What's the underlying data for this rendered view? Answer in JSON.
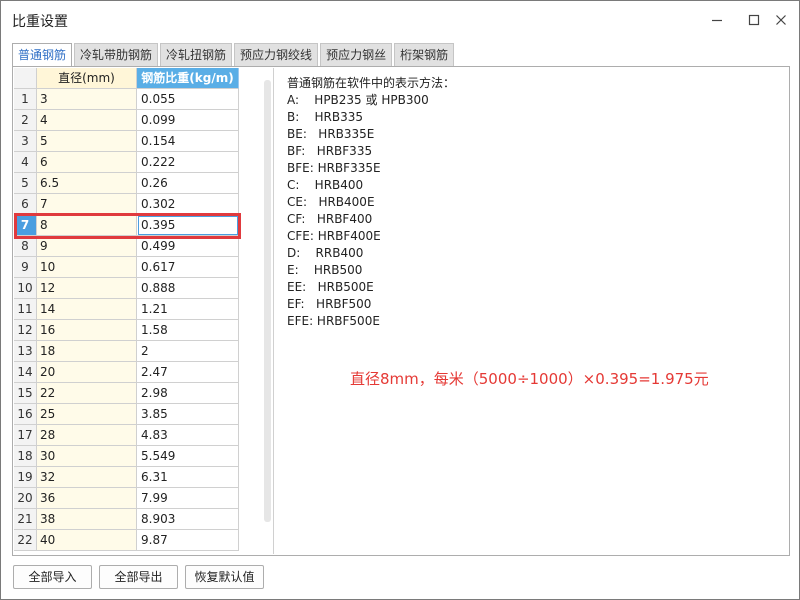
{
  "window": {
    "title": "比重设置"
  },
  "tabs": [
    {
      "label": "普通钢筋",
      "active": true
    },
    {
      "label": "冷轧带肋钢筋",
      "active": false
    },
    {
      "label": "冷轧扭钢筋",
      "active": false
    },
    {
      "label": "预应力钢绞线",
      "active": false
    },
    {
      "label": "预应力钢丝",
      "active": false
    },
    {
      "label": "桁架钢筋",
      "active": false
    }
  ],
  "table": {
    "headers": {
      "diameter": "直径(mm)",
      "weight": "钢筋比重(kg/m)"
    },
    "rows": [
      {
        "num": "1",
        "diameter": "3",
        "weight": "0.055"
      },
      {
        "num": "2",
        "diameter": "4",
        "weight": "0.099"
      },
      {
        "num": "3",
        "diameter": "5",
        "weight": "0.154"
      },
      {
        "num": "4",
        "diameter": "6",
        "weight": "0.222"
      },
      {
        "num": "5",
        "diameter": "6.5",
        "weight": "0.26"
      },
      {
        "num": "6",
        "diameter": "7",
        "weight": "0.302"
      },
      {
        "num": "7",
        "diameter": "8",
        "weight": "0.395"
      },
      {
        "num": "8",
        "diameter": "9",
        "weight": "0.499"
      },
      {
        "num": "9",
        "diameter": "10",
        "weight": "0.617"
      },
      {
        "num": "10",
        "diameter": "12",
        "weight": "0.888"
      },
      {
        "num": "11",
        "diameter": "14",
        "weight": "1.21"
      },
      {
        "num": "12",
        "diameter": "16",
        "weight": "1.58"
      },
      {
        "num": "13",
        "diameter": "18",
        "weight": "2"
      },
      {
        "num": "14",
        "diameter": "20",
        "weight": "2.47"
      },
      {
        "num": "15",
        "diameter": "22",
        "weight": "2.98"
      },
      {
        "num": "16",
        "diameter": "25",
        "weight": "3.85"
      },
      {
        "num": "17",
        "diameter": "28",
        "weight": "4.83"
      },
      {
        "num": "18",
        "diameter": "30",
        "weight": "5.549"
      },
      {
        "num": "19",
        "diameter": "32",
        "weight": "6.31"
      },
      {
        "num": "20",
        "diameter": "36",
        "weight": "7.99"
      },
      {
        "num": "21",
        "diameter": "38",
        "weight": "8.903"
      },
      {
        "num": "22",
        "diameter": "40",
        "weight": "9.87"
      }
    ],
    "selected_row": "7"
  },
  "info": {
    "lines": [
      "普通钢筋在软件中的表示方法：",
      "A:    HPB235 或 HPB300",
      "B:    HRB335",
      "BE:   HRB335E",
      "BF:   HRBF335",
      "BFE: HRBF335E",
      "C:    HRB400",
      "CE:   HRB400E",
      "CF:   HRBF400",
      "CFE: HRBF400E",
      "D:    RRB400",
      "E:    HRB500",
      "EE:   HRB500E",
      "EF:   HRBF500",
      "EFE: HRBF500E"
    ]
  },
  "note": "直径8mm，每米（5000÷1000）×0.395=1.975元",
  "buttons": {
    "import_all": "全部导入",
    "export_all": "全部导出",
    "restore_default": "恢复默认值"
  },
  "colors": {
    "accent": "#4a9ee0",
    "header_blue": "#5aaee6",
    "highlight_red": "#e03a3e",
    "note_red": "#e53935"
  }
}
